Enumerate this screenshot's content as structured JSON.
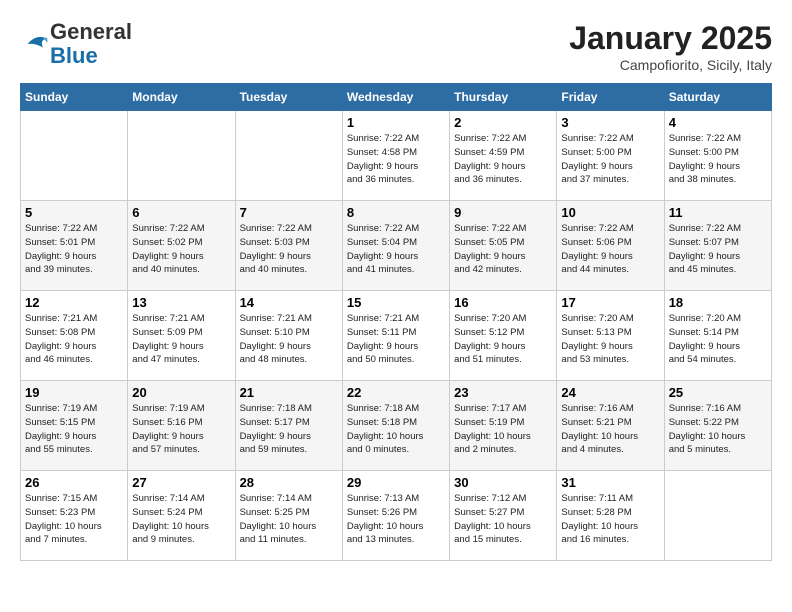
{
  "logo": {
    "general": "General",
    "blue": "Blue"
  },
  "header": {
    "month": "January 2025",
    "location": "Campofiorito, Sicily, Italy"
  },
  "weekdays": [
    "Sunday",
    "Monday",
    "Tuesday",
    "Wednesday",
    "Thursday",
    "Friday",
    "Saturday"
  ],
  "weeks": [
    [
      {
        "day": "",
        "info": ""
      },
      {
        "day": "",
        "info": ""
      },
      {
        "day": "",
        "info": ""
      },
      {
        "day": "1",
        "info": "Sunrise: 7:22 AM\nSunset: 4:58 PM\nDaylight: 9 hours\nand 36 minutes."
      },
      {
        "day": "2",
        "info": "Sunrise: 7:22 AM\nSunset: 4:59 PM\nDaylight: 9 hours\nand 36 minutes."
      },
      {
        "day": "3",
        "info": "Sunrise: 7:22 AM\nSunset: 5:00 PM\nDaylight: 9 hours\nand 37 minutes."
      },
      {
        "day": "4",
        "info": "Sunrise: 7:22 AM\nSunset: 5:00 PM\nDaylight: 9 hours\nand 38 minutes."
      }
    ],
    [
      {
        "day": "5",
        "info": "Sunrise: 7:22 AM\nSunset: 5:01 PM\nDaylight: 9 hours\nand 39 minutes."
      },
      {
        "day": "6",
        "info": "Sunrise: 7:22 AM\nSunset: 5:02 PM\nDaylight: 9 hours\nand 40 minutes."
      },
      {
        "day": "7",
        "info": "Sunrise: 7:22 AM\nSunset: 5:03 PM\nDaylight: 9 hours\nand 40 minutes."
      },
      {
        "day": "8",
        "info": "Sunrise: 7:22 AM\nSunset: 5:04 PM\nDaylight: 9 hours\nand 41 minutes."
      },
      {
        "day": "9",
        "info": "Sunrise: 7:22 AM\nSunset: 5:05 PM\nDaylight: 9 hours\nand 42 minutes."
      },
      {
        "day": "10",
        "info": "Sunrise: 7:22 AM\nSunset: 5:06 PM\nDaylight: 9 hours\nand 44 minutes."
      },
      {
        "day": "11",
        "info": "Sunrise: 7:22 AM\nSunset: 5:07 PM\nDaylight: 9 hours\nand 45 minutes."
      }
    ],
    [
      {
        "day": "12",
        "info": "Sunrise: 7:21 AM\nSunset: 5:08 PM\nDaylight: 9 hours\nand 46 minutes."
      },
      {
        "day": "13",
        "info": "Sunrise: 7:21 AM\nSunset: 5:09 PM\nDaylight: 9 hours\nand 47 minutes."
      },
      {
        "day": "14",
        "info": "Sunrise: 7:21 AM\nSunset: 5:10 PM\nDaylight: 9 hours\nand 48 minutes."
      },
      {
        "day": "15",
        "info": "Sunrise: 7:21 AM\nSunset: 5:11 PM\nDaylight: 9 hours\nand 50 minutes."
      },
      {
        "day": "16",
        "info": "Sunrise: 7:20 AM\nSunset: 5:12 PM\nDaylight: 9 hours\nand 51 minutes."
      },
      {
        "day": "17",
        "info": "Sunrise: 7:20 AM\nSunset: 5:13 PM\nDaylight: 9 hours\nand 53 minutes."
      },
      {
        "day": "18",
        "info": "Sunrise: 7:20 AM\nSunset: 5:14 PM\nDaylight: 9 hours\nand 54 minutes."
      }
    ],
    [
      {
        "day": "19",
        "info": "Sunrise: 7:19 AM\nSunset: 5:15 PM\nDaylight: 9 hours\nand 55 minutes."
      },
      {
        "day": "20",
        "info": "Sunrise: 7:19 AM\nSunset: 5:16 PM\nDaylight: 9 hours\nand 57 minutes."
      },
      {
        "day": "21",
        "info": "Sunrise: 7:18 AM\nSunset: 5:17 PM\nDaylight: 9 hours\nand 59 minutes."
      },
      {
        "day": "22",
        "info": "Sunrise: 7:18 AM\nSunset: 5:18 PM\nDaylight: 10 hours\nand 0 minutes."
      },
      {
        "day": "23",
        "info": "Sunrise: 7:17 AM\nSunset: 5:19 PM\nDaylight: 10 hours\nand 2 minutes."
      },
      {
        "day": "24",
        "info": "Sunrise: 7:16 AM\nSunset: 5:21 PM\nDaylight: 10 hours\nand 4 minutes."
      },
      {
        "day": "25",
        "info": "Sunrise: 7:16 AM\nSunset: 5:22 PM\nDaylight: 10 hours\nand 5 minutes."
      }
    ],
    [
      {
        "day": "26",
        "info": "Sunrise: 7:15 AM\nSunset: 5:23 PM\nDaylight: 10 hours\nand 7 minutes."
      },
      {
        "day": "27",
        "info": "Sunrise: 7:14 AM\nSunset: 5:24 PM\nDaylight: 10 hours\nand 9 minutes."
      },
      {
        "day": "28",
        "info": "Sunrise: 7:14 AM\nSunset: 5:25 PM\nDaylight: 10 hours\nand 11 minutes."
      },
      {
        "day": "29",
        "info": "Sunrise: 7:13 AM\nSunset: 5:26 PM\nDaylight: 10 hours\nand 13 minutes."
      },
      {
        "day": "30",
        "info": "Sunrise: 7:12 AM\nSunset: 5:27 PM\nDaylight: 10 hours\nand 15 minutes."
      },
      {
        "day": "31",
        "info": "Sunrise: 7:11 AM\nSunset: 5:28 PM\nDaylight: 10 hours\nand 16 minutes."
      },
      {
        "day": "",
        "info": ""
      }
    ]
  ]
}
